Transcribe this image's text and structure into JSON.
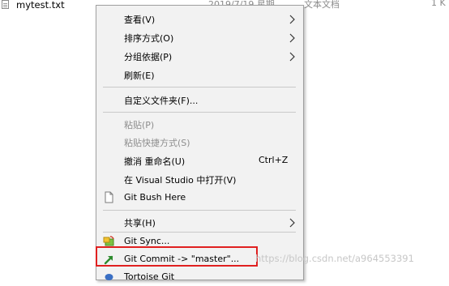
{
  "file_row": {
    "name": "mytest.txt",
    "date": "2019/7/19 星期",
    "type": "文本文档",
    "size": "1 K"
  },
  "context_menu": {
    "items": [
      {
        "label": "查看(V)",
        "submenu": true
      },
      {
        "label": "排序方式(O)",
        "submenu": true
      },
      {
        "label": "分组依据(P)",
        "submenu": true
      },
      {
        "label": "刷新(E)"
      },
      {
        "label": "自定义文件夹(F)..."
      },
      {
        "label": "粘贴(P)",
        "disabled": true
      },
      {
        "label": "粘贴快捷方式(S)",
        "disabled": true
      },
      {
        "label": "撤消 重命名(U)",
        "shortcut": "Ctrl+Z"
      },
      {
        "label": "在 Visual Studio 中打开(V)"
      },
      {
        "label": "Git Bush Here",
        "icon": "file-icon"
      },
      {
        "label": "共享(H)",
        "submenu": true
      },
      {
        "label": "Git Sync...",
        "icon": "git-sync-icon"
      },
      {
        "label": "Git Commit -> \"master\"...",
        "icon": "git-commit-arrow-icon"
      },
      {
        "label": "Tortoise Git",
        "icon": "tortoise-git-icon"
      }
    ]
  },
  "watermark": "https://blog.csdn.net/a964553391",
  "colors": {
    "menu_bg": "#f2f2f2",
    "highlight": "#e02020",
    "disabled_text": "#8d8d8d"
  }
}
